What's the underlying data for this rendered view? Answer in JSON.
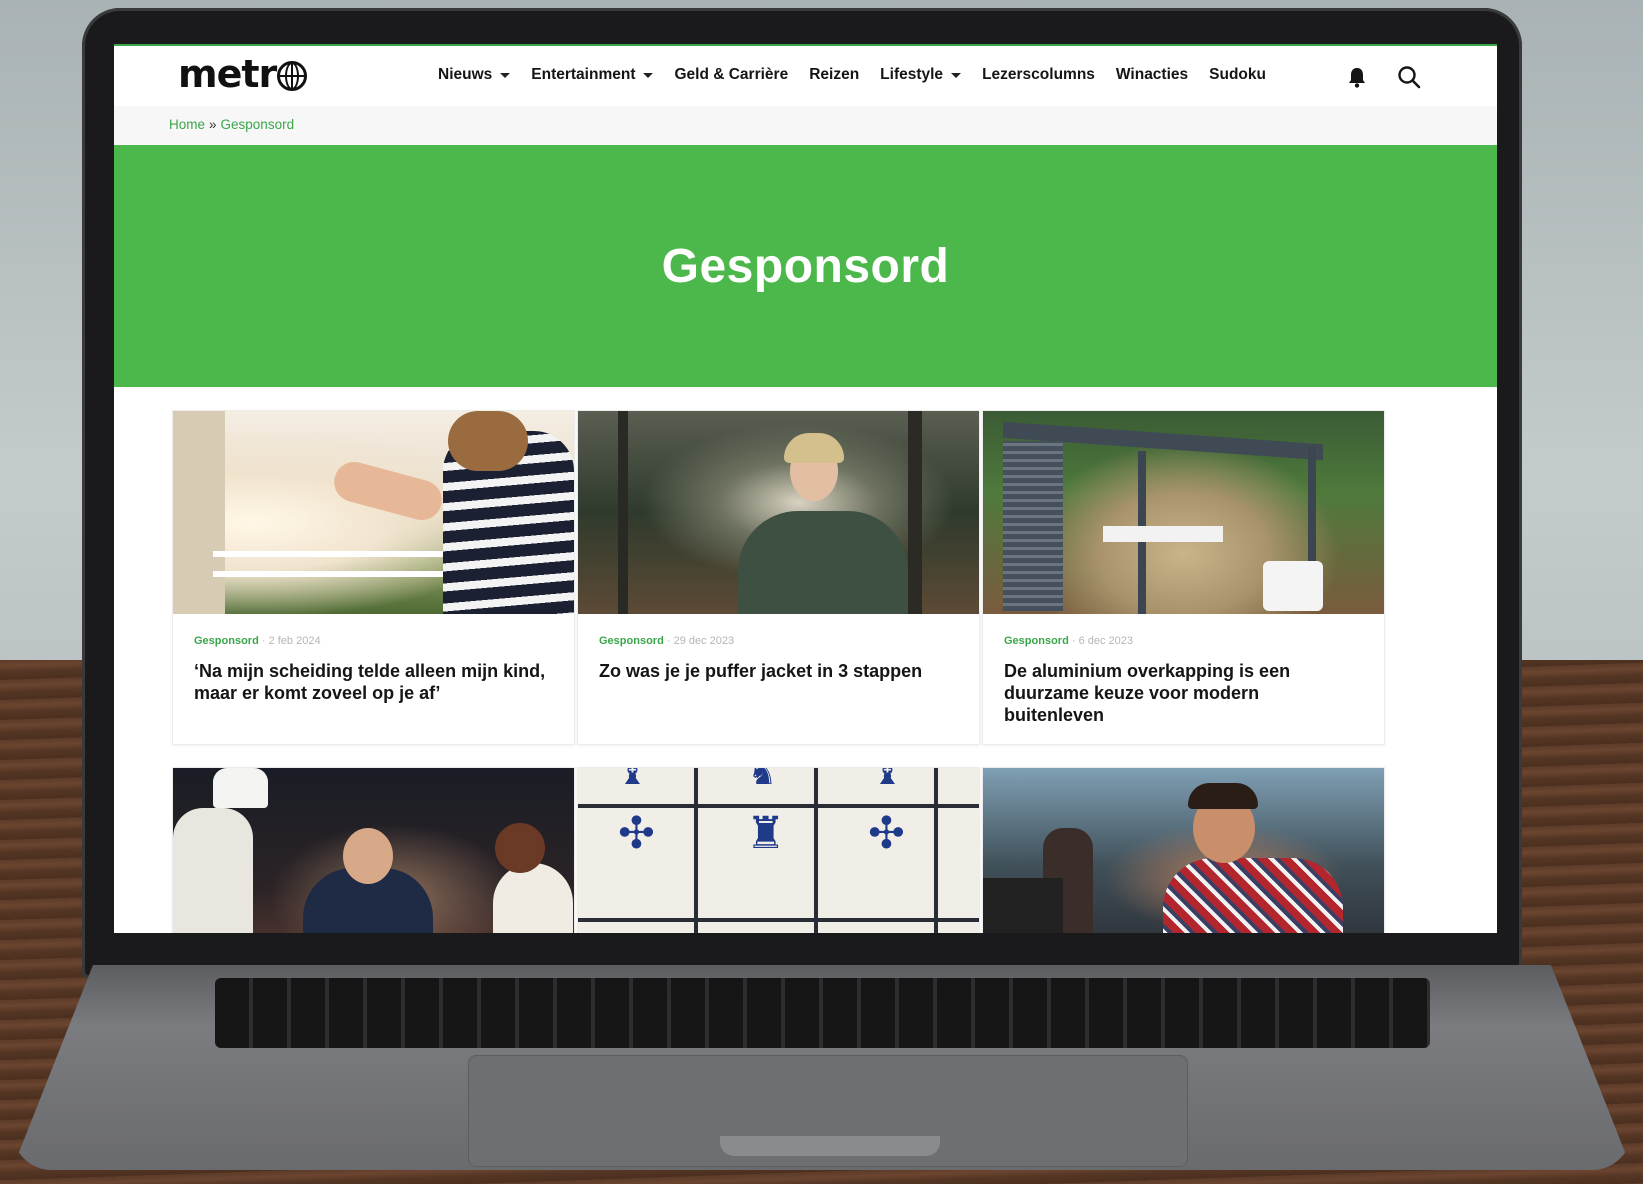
{
  "site": {
    "logo_text": "metr",
    "nav": [
      {
        "label": "Nieuws",
        "dropdown": true
      },
      {
        "label": "Entertainment",
        "dropdown": true
      },
      {
        "label": "Geld & Carrière",
        "dropdown": false
      },
      {
        "label": "Reizen",
        "dropdown": false
      },
      {
        "label": "Lifestyle",
        "dropdown": true
      },
      {
        "label": "Lezerscolumns",
        "dropdown": false
      },
      {
        "label": "Winacties",
        "dropdown": false
      },
      {
        "label": "Sudoku",
        "dropdown": false
      }
    ],
    "icons": {
      "notifications": "bell-icon",
      "search": "search-icon"
    }
  },
  "breadcrumb": {
    "home": "Home",
    "separator": "»",
    "current": "Gesponsord"
  },
  "hero": {
    "title": "Gesponsord"
  },
  "colors": {
    "brand_green": "#4cb74b",
    "link_green": "#3aa64a"
  },
  "articles": [
    {
      "category": "Gesponsord",
      "date": "· 2 feb 2024",
      "title": "‘Na mijn scheiding telde alleen mijn kind, maar er komt zoveel op je af’"
    },
    {
      "category": "Gesponsord",
      "date": "· 29 dec 2023",
      "title": "Zo was je je puffer jacket in 3 stappen"
    },
    {
      "category": "Gesponsord",
      "date": "· 6 dec 2023",
      "title": "De aluminium overkapping is een duurzame keuze voor modern buitenleven"
    },
    {
      "category": "",
      "date": "",
      "title": ""
    },
    {
      "category": "",
      "date": "",
      "title": ""
    },
    {
      "category": "",
      "date": "",
      "title": ""
    }
  ]
}
